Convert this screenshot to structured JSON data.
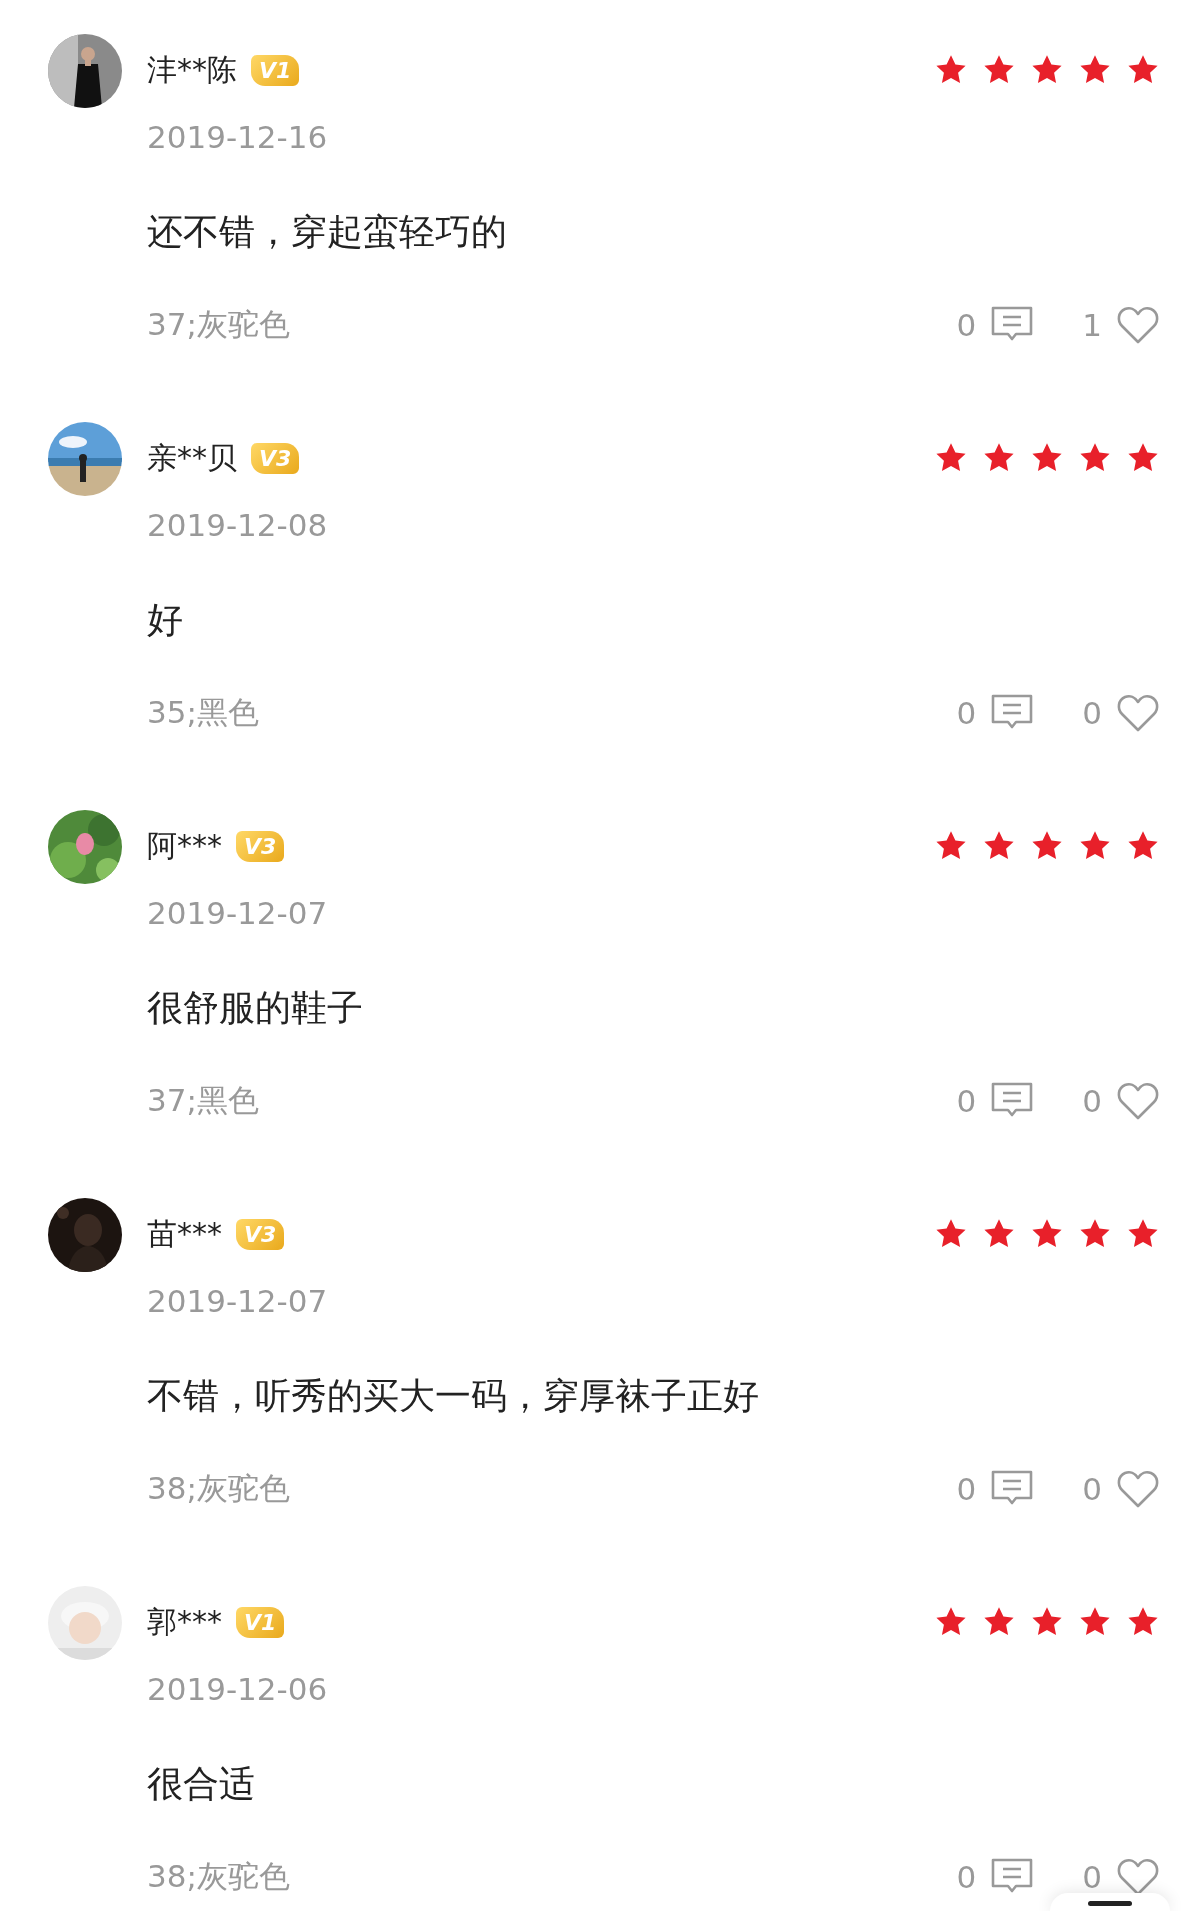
{
  "reviews": [
    {
      "user": "沣**陈",
      "badge": "V1",
      "stars": 5,
      "date": "2019-12-16",
      "content": "还不错，穿起蛮轻巧的",
      "spec": "37;灰驼色",
      "comments": "0",
      "likes": "1"
    },
    {
      "user": "亲**贝",
      "badge": "V3",
      "stars": 5,
      "date": "2019-12-08",
      "content": "好",
      "spec": "35;黑色",
      "comments": "0",
      "likes": "0"
    },
    {
      "user": "阿***",
      "badge": "V3",
      "stars": 5,
      "date": "2019-12-07",
      "content": "很舒服的鞋子",
      "spec": "37;黑色",
      "comments": "0",
      "likes": "0"
    },
    {
      "user": "苗***",
      "badge": "V3",
      "stars": 5,
      "date": "2019-12-07",
      "content": "不错，听秀的买大一码，穿厚袜子正好",
      "spec": "38;灰驼色",
      "comments": "0",
      "likes": "0"
    },
    {
      "user": "郭***",
      "badge": "V1",
      "stars": 5,
      "date": "2019-12-06",
      "content": "很合适",
      "spec": "38;灰驼色",
      "comments": "0",
      "likes": "0"
    }
  ]
}
